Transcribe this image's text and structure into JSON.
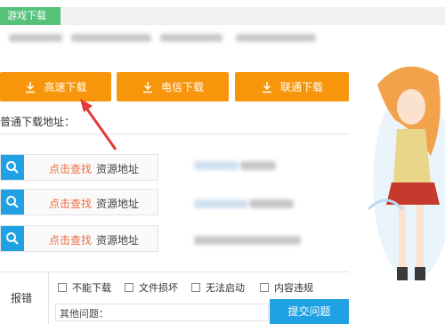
{
  "header": {
    "tab_label": "游戏下载"
  },
  "download_buttons": [
    {
      "label": "高速下载"
    },
    {
      "label": "电信下载"
    },
    {
      "label": "联通下载"
    }
  ],
  "normal_download_label": "普通下载地址：",
  "resource_rows": [
    {
      "find_label": "点击查找",
      "resource_label": "资源地址"
    },
    {
      "find_label": "点击查找",
      "resource_label": "资源地址"
    },
    {
      "find_label": "点击查找",
      "resource_label": "资源地址"
    }
  ],
  "report": {
    "title": "报错",
    "options": [
      "不能下载",
      "文件损坏",
      "无法启动",
      "内容违规"
    ],
    "other_label": "其他问题：",
    "submit_label": "提交问题"
  },
  "colors": {
    "accent_orange": "#f7950b",
    "accent_blue": "#1fa1e4",
    "tab_green": "#55c27a",
    "link_red": "#f06a3e",
    "annotation_arrow": "#e53935"
  },
  "icons": {
    "download": "download-icon",
    "search": "magnifier-icon"
  }
}
